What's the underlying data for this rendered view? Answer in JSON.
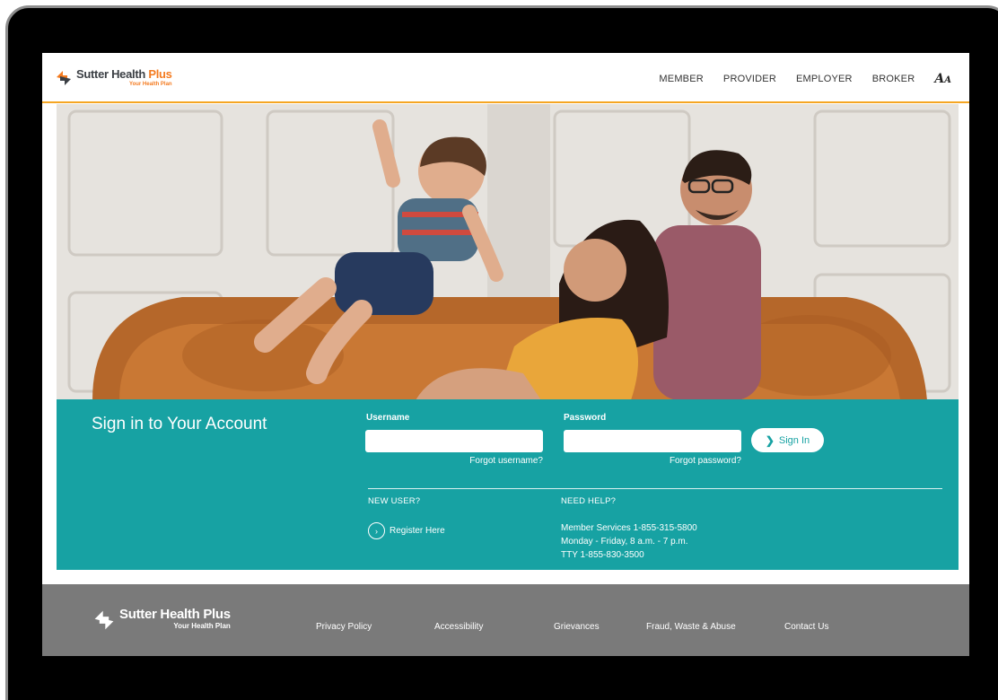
{
  "brand": {
    "name_part1": "Sutter Health",
    "name_part2": "Plus",
    "tagline": "Your Health Plan",
    "footer_name": "Sutter Health Plus",
    "footer_tagline": "Your Health Plan",
    "colors": {
      "orange": "#f47b20",
      "teal": "#17a2a3",
      "charcoal": "#3b3f44",
      "footer": "#7a7a7a"
    }
  },
  "nav": {
    "items": [
      "MEMBER",
      "PROVIDER",
      "EMPLOYER",
      "BROKER"
    ],
    "a11y_icon": "text-size-icon",
    "a11y_label": "AA"
  },
  "hero": {
    "image": "family-on-sofa-photo"
  },
  "signin": {
    "title": "Sign in to Your Account",
    "username_label": "Username",
    "username_value": "",
    "password_label": "Password",
    "password_value": "",
    "forgot_username": "Forgot username?",
    "forgot_password": "Forgot password?",
    "button_label": "Sign In",
    "new_user_heading": "NEW USER?",
    "register_label": "Register Here",
    "help_heading": "NEED HELP?",
    "help_lines": [
      "Member Services 1-855-315-5800",
      "Monday - Friday, 8 a.m. - 7 p.m.",
      "TTY 1-855-830-3500"
    ]
  },
  "footer": {
    "links": [
      "Privacy Policy",
      "Accessibility",
      "Grievances",
      "Fraud, Waste & Abuse",
      "Contact Us"
    ]
  }
}
